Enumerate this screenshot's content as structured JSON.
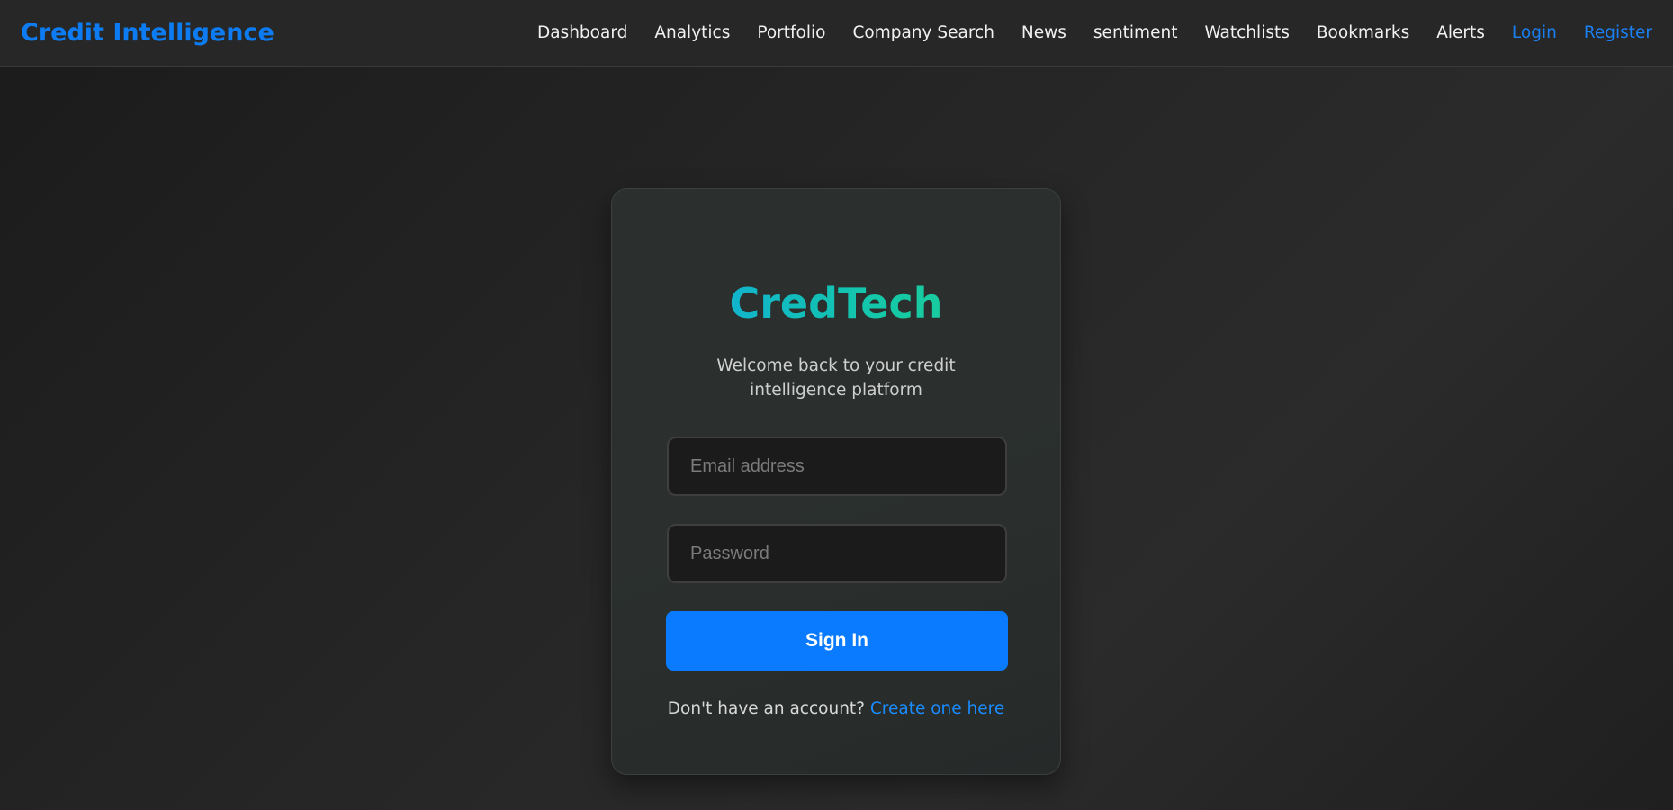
{
  "navbar": {
    "brand": "Credit Intelligence",
    "links": [
      {
        "label": "Dashboard"
      },
      {
        "label": "Analytics"
      },
      {
        "label": "Portfolio"
      },
      {
        "label": "Company Search"
      },
      {
        "label": "News"
      },
      {
        "label": "sentiment"
      },
      {
        "label": "Watchlists"
      },
      {
        "label": "Bookmarks"
      },
      {
        "label": "Alerts"
      },
      {
        "label": "Login"
      },
      {
        "label": "Register"
      }
    ]
  },
  "login_card": {
    "title": "CredTech",
    "subtitle": "Welcome back to your credit intelligence platform",
    "email_placeholder": "Email address",
    "password_placeholder": "Password",
    "submit_label": "Sign In",
    "footer_text": "Don't have an account?",
    "footer_link": "Create one here"
  },
  "colors": {
    "accent": "#0a7bff",
    "brand": "#0d7cf2",
    "title_gradient_start": "#0ea5e9",
    "title_gradient_end": "#22d38e",
    "background": "#232323",
    "card": "#2b2f2e"
  }
}
